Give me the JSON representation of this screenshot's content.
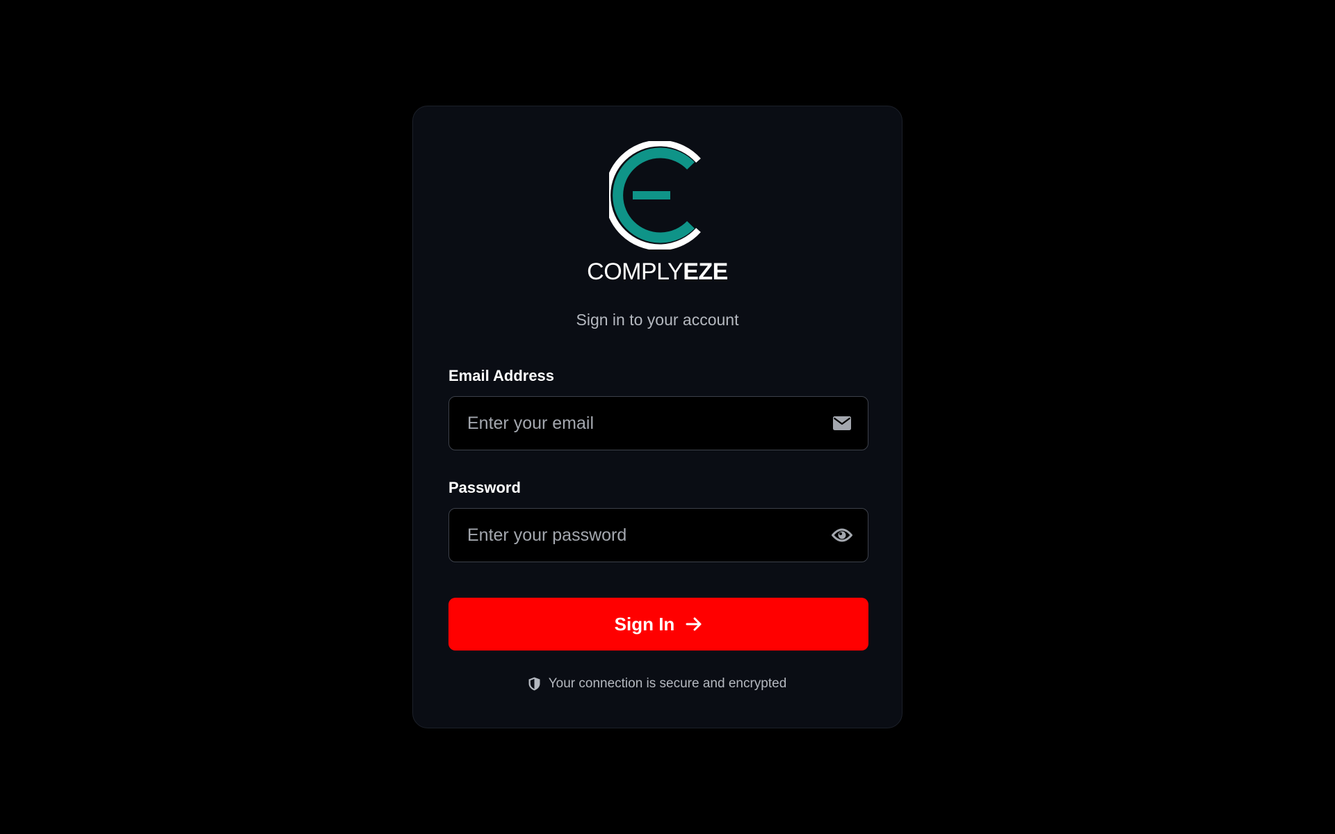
{
  "brand": {
    "name_light": "COMPLY",
    "name_bold": "EZE",
    "logo_icon": "complyeze-logo",
    "logo_ring_color": "#ffffff",
    "logo_accent_color": "#0f9488"
  },
  "login": {
    "subtitle": "Sign in to your account",
    "email": {
      "label": "Email Address",
      "placeholder": "Enter your email",
      "value": "",
      "icon": "envelope-icon"
    },
    "password": {
      "label": "Password",
      "placeholder": "Enter your password",
      "value": "",
      "icon": "eye-icon"
    },
    "submit": {
      "label": "Sign In",
      "icon": "arrow-right-icon",
      "color": "#ff0000"
    },
    "security_note": {
      "text": "Your connection is secure and encrypted",
      "icon": "shield-icon"
    }
  }
}
